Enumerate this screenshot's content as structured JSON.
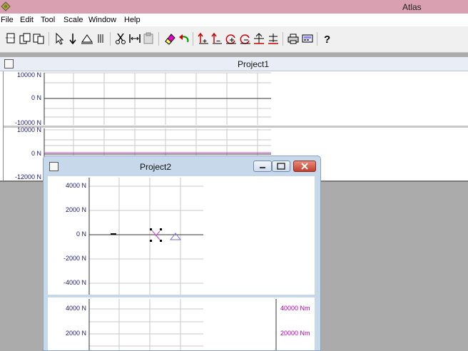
{
  "app": {
    "title": "Atlas"
  },
  "menu": [
    "File",
    "Edit",
    "Tool",
    "Scale",
    "Window",
    "Help"
  ],
  "toolbar": {
    "icons": [
      "new-doc-icon",
      "open-doc-icon",
      "copy-doc-icon",
      "pointer-icon",
      "force-arrow-icon",
      "support-icon",
      "hatch-icon",
      "cut-icon",
      "distributed-load-icon",
      "paste-icon",
      "eraser-icon",
      "undo-icon",
      "moment-up-icon",
      "moment-down-icon",
      "rotate-cw-icon",
      "rotate-ccw-icon",
      "grid-plus-icon",
      "grid-minus-icon",
      "print-icon",
      "calculator-icon",
      "help-icon"
    ]
  },
  "project1": {
    "title": "Project1",
    "panel1_ticks": [
      "10000 N",
      "0 N",
      "-10000 N"
    ],
    "panel2_ticks": [
      "10000 N",
      "0 N",
      "-12000 N"
    ]
  },
  "project2": {
    "title": "Project2",
    "panel1_ticks": [
      "4000 N",
      "2000 N",
      "0 N",
      "-2000 N",
      "-4000 N"
    ],
    "panel2_left_ticks": [
      "4000 N",
      "2000 N"
    ],
    "panel2_right_ticks": [
      "40000 Nm",
      "20000 Nm"
    ]
  },
  "colors": {
    "titlebar": "#d8a0b0",
    "axis_text": "#1a1a6e",
    "moment_text": "#b000b0",
    "moment_line": "#cc44cc"
  }
}
